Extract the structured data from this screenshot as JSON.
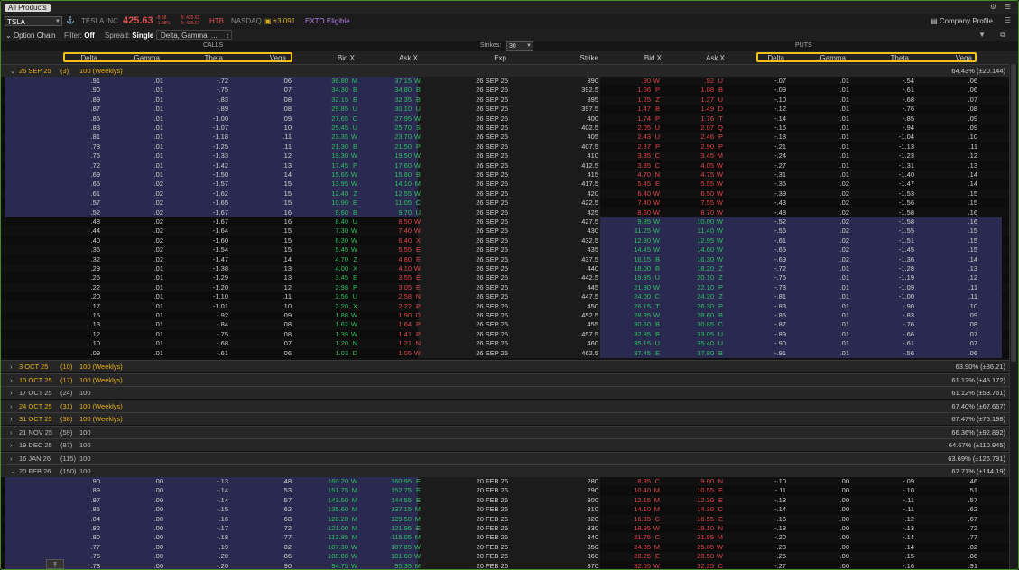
{
  "app": {
    "tab_label": "All Products",
    "pin_icon": "pin-icon",
    "menu_icon": "hamburger-icon"
  },
  "quote": {
    "symbol": "TSLA",
    "company": "TESLA INC",
    "last": "425.63",
    "net_change": "-8.58",
    "net_change_pct": "-1.98%",
    "bid": "B: 425.62",
    "ask": "A: 425.67",
    "htb": "HTB",
    "exchange": "NASDAQ",
    "pl": "±3.091",
    "exto": "EXTO Eligible",
    "company_profile": "Company Profile"
  },
  "toolbar": {
    "title": "Option Chain",
    "filter_label": "Filter:",
    "filter_value": "Off",
    "spread_label": "Spread:",
    "spread_value": "Single",
    "layout_value": "Delta, Gamma, ..."
  },
  "section": {
    "calls": "CALLS",
    "puts": "PUTS",
    "strikes_label": "Strikes:",
    "strikes_value": "30"
  },
  "columns": {
    "calls": [
      "Delta",
      "Gamma",
      "Theta",
      "Vega",
      "Bid X",
      "Ask X"
    ],
    "mid": [
      "Exp",
      "Strike"
    ],
    "puts": [
      "Bid X",
      "Ask X",
      "Delta",
      "Gamma",
      "Theta",
      "Vega"
    ]
  },
  "colors": {
    "highlight": "#f3c21a",
    "itm_bg": "#2a2a50",
    "green": "#2fbf5f",
    "red": "#e0454a",
    "weekly": "#e7b020"
  },
  "first_expiry": {
    "label": "26 SEP 25",
    "days": "(3)",
    "mult": "100 (Weeklys)",
    "iv": "64.43% (±20.144)"
  },
  "chain1": [
    {
      "exp": "26 SEP 25",
      "strike": "390",
      "c": [
        ".91",
        ".01",
        "-.72",
        ".06",
        "36.80",
        "M",
        "37.15",
        "W"
      ],
      "p": [
        ".90",
        "W",
        ".92",
        "U",
        "-.07",
        ".01",
        "-.54",
        ".06"
      ],
      "citm": true,
      "pitm": false
    },
    {
      "exp": "26 SEP 25",
      "strike": "392.5",
      "c": [
        ".90",
        ".01",
        "-.75",
        ".07",
        "34.30",
        "B",
        "34.80",
        "B"
      ],
      "p": [
        "1.06",
        "P",
        "1.08",
        "B",
        "-.09",
        ".01",
        "-.61",
        ".06"
      ],
      "citm": true,
      "pitm": false
    },
    {
      "exp": "26 SEP 25",
      "strike": "395",
      "c": [
        ".89",
        ".01",
        "-.83",
        ".08",
        "32.15",
        "B",
        "32.35",
        "B"
      ],
      "p": [
        "1.25",
        "Z",
        "1.27",
        "U",
        "-.10",
        ".01",
        "-.68",
        ".07"
      ],
      "citm": true,
      "pitm": false
    },
    {
      "exp": "26 SEP 25",
      "strike": "397.5",
      "c": [
        ".87",
        ".01",
        "-.89",
        ".08",
        "29.85",
        "U",
        "30.10",
        "U"
      ],
      "p": [
        "1.47",
        "B",
        "1.49",
        "D",
        "-.12",
        ".01",
        "-.76",
        ".08"
      ],
      "citm": true,
      "pitm": false
    },
    {
      "exp": "26 SEP 25",
      "strike": "400",
      "c": [
        ".85",
        ".01",
        "-1.00",
        ".09",
        "27.65",
        "C",
        "27.95",
        "W"
      ],
      "p": [
        "1.74",
        "P",
        "1.76",
        "T",
        "-.14",
        ".01",
        "-.85",
        ".09"
      ],
      "citm": true,
      "pitm": false
    },
    {
      "exp": "26 SEP 25",
      "strike": "402.5",
      "c": [
        ".83",
        ".01",
        "-1.07",
        ".10",
        "25.45",
        "U",
        "25.70",
        "S"
      ],
      "p": [
        "2.05",
        "U",
        "2.07",
        "Q",
        "-.16",
        ".01",
        "-.94",
        ".09"
      ],
      "citm": true,
      "pitm": false
    },
    {
      "exp": "26 SEP 25",
      "strike": "405",
      "c": [
        ".81",
        ".01",
        "-1.18",
        ".11",
        "23.35",
        "W",
        "23.70",
        "W"
      ],
      "p": [
        "2.43",
        "U",
        "2.46",
        "P",
        "-.18",
        ".01",
        "-1.04",
        ".10"
      ],
      "citm": true,
      "pitm": false
    },
    {
      "exp": "26 SEP 25",
      "strike": "407.5",
      "c": [
        ".78",
        ".01",
        "-1.25",
        ".11",
        "21.30",
        "B",
        "21.50",
        "P"
      ],
      "p": [
        "2.87",
        "P",
        "2.90",
        "P",
        "-.21",
        ".01",
        "-1.13",
        ".11"
      ],
      "citm": true,
      "pitm": false
    },
    {
      "exp": "26 SEP 25",
      "strike": "410",
      "c": [
        ".76",
        ".01",
        "-1.33",
        ".12",
        "19.30",
        "W",
        "19.50",
        "W"
      ],
      "p": [
        "3.35",
        "C",
        "3.45",
        "M",
        "-.24",
        ".01",
        "-1.23",
        ".12"
      ],
      "citm": true,
      "pitm": false
    },
    {
      "exp": "26 SEP 25",
      "strike": "412.5",
      "c": [
        ".72",
        ".01",
        "-1.42",
        ".13",
        "17.45",
        "P",
        "17.60",
        "W"
      ],
      "p": [
        "3.95",
        "C",
        "4.05",
        "W",
        "-.27",
        ".01",
        "-1.31",
        ".13"
      ],
      "citm": true,
      "pitm": false
    },
    {
      "exp": "26 SEP 25",
      "strike": "415",
      "c": [
        ".69",
        ".01",
        "-1.50",
        ".14",
        "15.65",
        "W",
        "15.80",
        "B"
      ],
      "p": [
        "4.70",
        "N",
        "4.75",
        "W",
        "-.31",
        ".01",
        "-1.40",
        ".14"
      ],
      "citm": true,
      "pitm": false
    },
    {
      "exp": "26 SEP 25",
      "strike": "417.5",
      "c": [
        ".65",
        ".02",
        "-1.57",
        ".15",
        "13.95",
        "W",
        "14.10",
        "M"
      ],
      "p": [
        "5.45",
        "E",
        "5.55",
        "W",
        "-.35",
        ".02",
        "-1.47",
        ".14"
      ],
      "citm": true,
      "pitm": false
    },
    {
      "exp": "26 SEP 25",
      "strike": "420",
      "c": [
        ".61",
        ".02",
        "-1.62",
        ".15",
        "12.40",
        "Z",
        "12.55",
        "W"
      ],
      "p": [
        "6.40",
        "W",
        "6.50",
        "W",
        "-.39",
        ".02",
        "-1.53",
        ".15"
      ],
      "citm": true,
      "pitm": false
    },
    {
      "exp": "26 SEP 25",
      "strike": "422.5",
      "c": [
        ".57",
        ".02",
        "-1.65",
        ".15",
        "10.90",
        "E",
        "11.05",
        "C"
      ],
      "p": [
        "7.40",
        "W",
        "7.55",
        "W",
        "-.43",
        ".02",
        "-1.56",
        ".15"
      ],
      "citm": true,
      "pitm": false
    },
    {
      "exp": "26 SEP 25",
      "strike": "425",
      "c": [
        ".52",
        ".02",
        "-1.67",
        ".16",
        "9.60",
        "B",
        "9.70",
        "U"
      ],
      "p": [
        "8.60",
        "W",
        "8.70",
        "W",
        "-.48",
        ".02",
        "-1.58",
        ".16"
      ],
      "citm": true,
      "pitm": false
    },
    {
      "exp": "26 SEP 25",
      "strike": "427.5",
      "c": [
        ".48",
        ".02",
        "-1.67",
        ".16",
        "8.40",
        "U",
        "8.50",
        "W"
      ],
      "p": [
        "9.85",
        "W",
        "10.00",
        "W",
        "-.52",
        ".02",
        "-1.58",
        ".16"
      ],
      "citm": false,
      "pitm": true
    },
    {
      "exp": "26 SEP 25",
      "strike": "430",
      "c": [
        ".44",
        ".02",
        "-1.64",
        ".15",
        "7.30",
        "W",
        "7.40",
        "W"
      ],
      "p": [
        "11.25",
        "W",
        "11.40",
        "W",
        "-.56",
        ".02",
        "-1.55",
        ".15"
      ],
      "citm": false,
      "pitm": true
    },
    {
      "exp": "26 SEP 25",
      "strike": "432.5",
      "c": [
        ".40",
        ".02",
        "-1.60",
        ".15",
        "6.30",
        "W",
        "6.40",
        "X"
      ],
      "p": [
        "12.80",
        "W",
        "12.95",
        "W",
        "-.61",
        ".02",
        "-1.51",
        ".15"
      ],
      "citm": false,
      "pitm": true
    },
    {
      "exp": "26 SEP 25",
      "strike": "435",
      "c": [
        ".36",
        ".02",
        "-1.54",
        ".15",
        "5.45",
        "W",
        "5.55",
        "E"
      ],
      "p": [
        "14.45",
        "W",
        "14.60",
        "W",
        "-.65",
        ".02",
        "-1.45",
        ".15"
      ],
      "citm": false,
      "pitm": true
    },
    {
      "exp": "26 SEP 25",
      "strike": "437.5",
      "c": [
        ".32",
        ".02",
        "-1.47",
        ".14",
        "4.70",
        "Z",
        "4.80",
        "E"
      ],
      "p": [
        "16.15",
        "B",
        "16.30",
        "W",
        "-.69",
        ".02",
        "-1.36",
        ".14"
      ],
      "citm": false,
      "pitm": true
    },
    {
      "exp": "26 SEP 25",
      "strike": "440",
      "c": [
        ".29",
        ".01",
        "-1.38",
        ".13",
        "4.00",
        "X",
        "4.10",
        "W"
      ],
      "p": [
        "18.00",
        "B",
        "18.20",
        "Z",
        "-.72",
        ".01",
        "-1.28",
        ".13"
      ],
      "citm": false,
      "pitm": true
    },
    {
      "exp": "26 SEP 25",
      "strike": "442.5",
      "c": [
        ".25",
        ".01",
        "-1.29",
        ".13",
        "3.45",
        "E",
        "3.55",
        "E"
      ],
      "p": [
        "19.95",
        "U",
        "20.10",
        "Z",
        "-.75",
        ".01",
        "-1.19",
        ".12"
      ],
      "citm": false,
      "pitm": true
    },
    {
      "exp": "26 SEP 25",
      "strike": "445",
      "c": [
        ".22",
        ".01",
        "-1.20",
        ".12",
        "2.98",
        "P",
        "3.05",
        "E"
      ],
      "p": [
        "21.90",
        "W",
        "22.10",
        "P",
        "-.78",
        ".01",
        "-1.09",
        ".11"
      ],
      "citm": false,
      "pitm": true
    },
    {
      "exp": "26 SEP 25",
      "strike": "447.5",
      "c": [
        ".20",
        ".01",
        "-1.10",
        ".11",
        "2.56",
        "U",
        "2.58",
        "N"
      ],
      "p": [
        "24.00",
        "C",
        "24.20",
        "Z",
        "-.81",
        ".01",
        "-1.00",
        ".11"
      ],
      "citm": false,
      "pitm": true
    },
    {
      "exp": "26 SEP 25",
      "strike": "450",
      "c": [
        ".17",
        ".01",
        "-1.01",
        ".10",
        "2.20",
        "X",
        "2.22",
        "P"
      ],
      "p": [
        "26.15",
        "T",
        "26.30",
        "P",
        "-.83",
        ".01",
        "-.90",
        ".10"
      ],
      "citm": false,
      "pitm": true
    },
    {
      "exp": "26 SEP 25",
      "strike": "452.5",
      "c": [
        ".15",
        ".01",
        "-.92",
        ".09",
        "1.88",
        "W",
        "1.90",
        "D"
      ],
      "p": [
        "28.35",
        "W",
        "28.60",
        "B",
        "-.85",
        ".01",
        "-.83",
        ".09"
      ],
      "citm": false,
      "pitm": true
    },
    {
      "exp": "26 SEP 25",
      "strike": "455",
      "c": [
        ".13",
        ".01",
        "-.84",
        ".08",
        "1.62",
        "W",
        "1.64",
        "P"
      ],
      "p": [
        "30.60",
        "B",
        "30.85",
        "C",
        "-.87",
        ".01",
        "-.76",
        ".08"
      ],
      "citm": false,
      "pitm": true
    },
    {
      "exp": "26 SEP 25",
      "strike": "457.5",
      "c": [
        ".12",
        ".01",
        "-.75",
        ".08",
        "1.39",
        "W",
        "1.41",
        "P"
      ],
      "p": [
        "32.85",
        "B",
        "33.05",
        "U",
        "-.89",
        ".01",
        "-.66",
        ".07"
      ],
      "citm": false,
      "pitm": true
    },
    {
      "exp": "26 SEP 25",
      "strike": "460",
      "c": [
        ".10",
        ".01",
        "-.68",
        ".07",
        "1.20",
        "N",
        "1.21",
        "N"
      ],
      "p": [
        "35.15",
        "U",
        "35.40",
        "U",
        "-.90",
        ".01",
        "-.61",
        ".07"
      ],
      "citm": false,
      "pitm": true
    },
    {
      "exp": "26 SEP 25",
      "strike": "462.5",
      "c": [
        ".09",
        ".01",
        "-.61",
        ".06",
        "1.03",
        "D",
        "1.05",
        "W"
      ],
      "p": [
        "37.45",
        "E",
        "37.80",
        "B",
        "-.91",
        ".01",
        "-.56",
        ".06"
      ],
      "citm": false,
      "pitm": true
    }
  ],
  "expirations": [
    {
      "label": "3 OCT 25",
      "days": "(10)",
      "mult": "100 (Weeklys)",
      "iv": "63.90% (±36.21)",
      "weekly": true
    },
    {
      "label": "10 OCT 25",
      "days": "(17)",
      "mult": "100 (Weeklys)",
      "iv": "61.12% (±45.172)",
      "weekly": true
    },
    {
      "label": "17 OCT 25",
      "days": "(24)",
      "mult": "100",
      "iv": "61.12% (±53.761)",
      "weekly": false
    },
    {
      "label": "24 OCT 25",
      "days": "(31)",
      "mult": "100 (Weeklys)",
      "iv": "67.40% (±67.667)",
      "weekly": true
    },
    {
      "label": "31 OCT 25",
      "days": "(38)",
      "mult": "100 (Weeklys)",
      "iv": "67.47% (±75.198)",
      "weekly": true
    },
    {
      "label": "21 NOV 25",
      "days": "(59)",
      "mult": "100",
      "iv": "66.36% (±92.892)",
      "weekly": false
    },
    {
      "label": "19 DEC 25",
      "days": "(87)",
      "mult": "100",
      "iv": "64.67% (±110.945)",
      "weekly": false
    },
    {
      "label": "16 JAN 26",
      "days": "(115)",
      "mult": "100",
      "iv": "63.69% (±126.791)",
      "weekly": false
    }
  ],
  "second_expiry": {
    "label": "20 FEB 26",
    "days": "(150)",
    "mult": "100",
    "iv": "62.71% (±144.19)"
  },
  "chain2": [
    {
      "exp": "20 FEB 26",
      "strike": "280",
      "c": [
        ".90",
        ".00",
        "-.13",
        ".48",
        "160.20",
        "W",
        "160.95",
        "E"
      ],
      "p": [
        "8.85",
        "C",
        "9.00",
        "N",
        "-.10",
        ".00",
        "-.09",
        ".46"
      ],
      "citm": true,
      "pitm": false
    },
    {
      "exp": "20 FEB 26",
      "strike": "290",
      "c": [
        ".89",
        ".00",
        "-.14",
        ".53",
        "151.75",
        "M",
        "152.75",
        "E"
      ],
      "p": [
        "10.40",
        "M",
        "10.55",
        "E",
        "-.11",
        ".00",
        "-.10",
        ".51"
      ],
      "citm": true,
      "pitm": false
    },
    {
      "exp": "20 FEB 26",
      "strike": "300",
      "c": [
        ".87",
        ".00",
        "-.14",
        ".57",
        "143.50",
        "M",
        "144.55",
        "E"
      ],
      "p": [
        "12.15",
        "M",
        "12.30",
        "E",
        "-.13",
        ".00",
        "-.11",
        ".57"
      ],
      "citm": true,
      "pitm": false
    },
    {
      "exp": "20 FEB 26",
      "strike": "310",
      "c": [
        ".85",
        ".00",
        "-.15",
        ".62",
        "135.60",
        "M",
        "137.15",
        "M"
      ],
      "p": [
        "14.10",
        "M",
        "14.30",
        "C",
        "-.14",
        ".00",
        "-.11",
        ".62"
      ],
      "citm": true,
      "pitm": false
    },
    {
      "exp": "20 FEB 26",
      "strike": "320",
      "c": [
        ".84",
        ".00",
        "-.16",
        ".68",
        "128.20",
        "M",
        "129.50",
        "M"
      ],
      "p": [
        "16.35",
        "C",
        "16.55",
        "E",
        "-.16",
        ".00",
        "-.12",
        ".67"
      ],
      "citm": true,
      "pitm": false
    },
    {
      "exp": "20 FEB 26",
      "strike": "330",
      "c": [
        ".82",
        ".00",
        "-.17",
        ".72",
        "121.00",
        "M",
        "121.95",
        "E"
      ],
      "p": [
        "18.95",
        "W",
        "19.10",
        "N",
        "-.18",
        ".00",
        "-.13",
        ".72"
      ],
      "citm": true,
      "pitm": false
    },
    {
      "exp": "20 FEB 26",
      "strike": "340",
      "c": [
        ".80",
        ".00",
        "-.18",
        ".77",
        "113.85",
        "M",
        "115.05",
        "M"
      ],
      "p": [
        "21.75",
        "C",
        "21.95",
        "M",
        "-.20",
        ".00",
        "-.14",
        ".77"
      ],
      "citm": true,
      "pitm": false
    },
    {
      "exp": "20 FEB 26",
      "strike": "350",
      "c": [
        ".77",
        ".00",
        "-.19",
        ".82",
        "107.30",
        "W",
        "107.85",
        "W"
      ],
      "p": [
        "24.85",
        "M",
        "25.05",
        "W",
        "-.23",
        ".00",
        "-.14",
        ".82"
      ],
      "citm": true,
      "pitm": false
    },
    {
      "exp": "20 FEB 26",
      "strike": "360",
      "c": [
        ".75",
        ".00",
        "-.20",
        ".86",
        "100.80",
        "W",
        "101.60",
        "W"
      ],
      "p": [
        "28.25",
        "E",
        "28.50",
        "W",
        "-.25",
        ".00",
        "-.15",
        ".86"
      ],
      "citm": true,
      "pitm": false
    },
    {
      "exp": "20 FEB 26",
      "strike": "370",
      "c": [
        ".73",
        ".00",
        "-.20",
        ".90",
        "94.75",
        "W",
        "95.35",
        "M"
      ],
      "p": [
        "32.05",
        "W",
        "32.25",
        "C",
        "-.27",
        ".00",
        "-.16",
        ".91"
      ],
      "citm": true,
      "pitm": false
    }
  ]
}
